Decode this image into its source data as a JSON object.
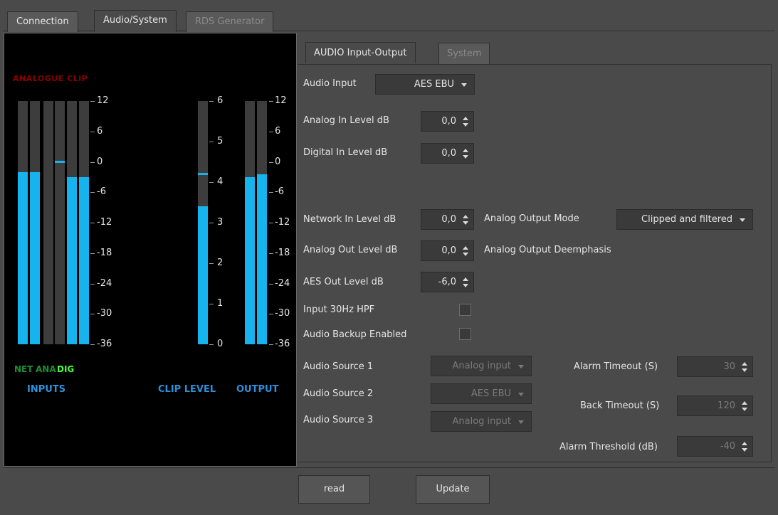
{
  "tabs": [
    {
      "label": "Connection"
    },
    {
      "label": "Audio/System"
    },
    {
      "label": "RDS Generator"
    }
  ],
  "meters": {
    "clip_indicator": "ANALOGUE CLIP",
    "scale_left": [
      "12",
      "6",
      "0",
      "-6",
      "-12",
      "-18",
      "-24",
      "-30",
      "-36"
    ],
    "scale_clip": [
      "6",
      "5",
      "4",
      "3",
      "2",
      "1",
      "0"
    ],
    "scale_right": [
      "12",
      "6",
      "0",
      "-6",
      "-12",
      "-18",
      "-24",
      "-30",
      "-36"
    ],
    "source_net": "NET",
    "source_ana": "ANA",
    "source_dig": "DIG",
    "inputs_label": "INPUTS",
    "clip_level_label": "CLIP LEVEL",
    "output_label": "OUTPUT",
    "bar_color": "#16b4ee",
    "input_levels_db": [
      -2,
      -2,
      null,
      null,
      -3,
      -3
    ],
    "input_peaks_db": [
      null,
      null,
      null,
      0,
      null,
      null
    ],
    "clip_level": 3.4,
    "clip_peak": 4.2,
    "output_levels_db": [
      -3,
      -2.5
    ]
  },
  "subtabs": [
    {
      "label": "AUDIO Input-Output"
    },
    {
      "label": "System"
    }
  ],
  "form": {
    "audio_input_label": "Audio Input",
    "audio_input_value": "AES EBU",
    "analog_in_label": "Analog In Level dB",
    "analog_in_value": "0,0",
    "digital_in_label": "Digital In Level dB",
    "digital_in_value": "0,0",
    "network_in_label": "Network In Level dB",
    "network_in_value": "0,0",
    "analog_output_mode_label": "Analog Output Mode",
    "analog_output_mode_value": "Clipped and filtered",
    "analog_out_label": "Analog Out Level dB",
    "analog_out_value": "0,0",
    "analog_output_deemphasis_label": "Analog Output Deemphasis",
    "aes_out_label": "AES Out Level dB",
    "aes_out_value": "-6,0",
    "hpf_label": "Input 30Hz HPF",
    "backup_label": "Audio Backup Enabled",
    "source1_label": "Audio Source 1",
    "source1_value": "Analog input",
    "source2_label": "Audio Source 2",
    "source2_value": "AES EBU",
    "source3_label": "Audio Source 3",
    "source3_value": "Analog input",
    "alarm_timeout_label": "Alarm Timeout (S)",
    "alarm_timeout_value": "30",
    "back_timeout_label": "Back Timeout (S)",
    "back_timeout_value": "120",
    "alarm_threshold_label": "Alarm Threshold (dB)",
    "alarm_threshold_value": "-40"
  },
  "buttons": {
    "read": "read",
    "update": "Update"
  }
}
